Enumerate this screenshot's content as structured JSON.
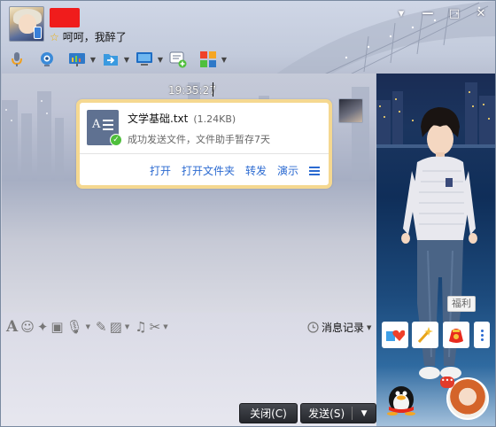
{
  "window": {
    "user_status": "呵呵，我醉了",
    "controls": [
      "▾",
      "—",
      "□",
      "✕"
    ]
  },
  "toolbar": {
    "items": [
      {
        "icon": "microphone-icon",
        "has_dropdown": false
      },
      {
        "icon": "camera-icon",
        "has_dropdown": false
      },
      {
        "icon": "presentation-icon",
        "has_dropdown": true
      },
      {
        "icon": "file-transfer-icon",
        "has_dropdown": true
      },
      {
        "icon": "remote-desktop-icon",
        "has_dropdown": true
      },
      {
        "icon": "create-group-icon",
        "has_dropdown": false
      },
      {
        "icon": "apps-icon",
        "has_dropdown": true
      }
    ]
  },
  "chat": {
    "timestamp": "19:35:27",
    "file_message": {
      "file_name": "文学基础.txt",
      "file_size": "(1.24KB)",
      "description": "成功发送文件，文件助手暂存7天",
      "actions": [
        "打开",
        "打开文件夹",
        "转发",
        "演示"
      ]
    }
  },
  "input_toolbar": {
    "icons": [
      "font-icon",
      "emoji-icon",
      "magic-icon",
      "video-icon",
      "voice-icon",
      "edit-icon",
      "image-icon",
      "music-icon",
      "scissors-icon"
    ],
    "history_label": "消息记录"
  },
  "buttons": {
    "close_label": "关闭(C)",
    "send_label": "发送(S)"
  },
  "side_panel": {
    "badge": "福利"
  },
  "colors": {
    "accent_link": "#2b6ad1",
    "card_border": "#f5d890",
    "username_redacted": "#f01c1c"
  }
}
